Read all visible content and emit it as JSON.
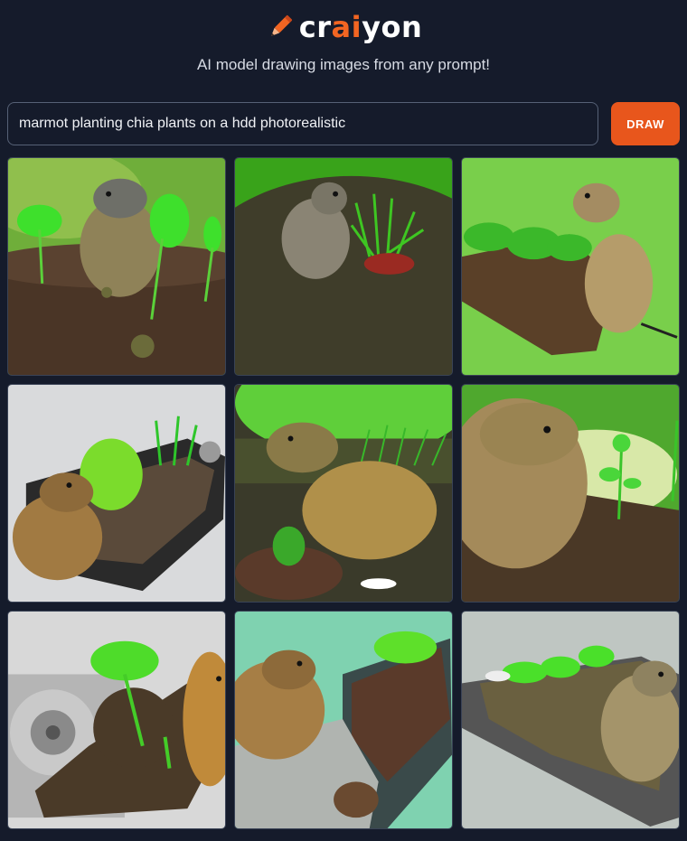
{
  "brand": {
    "name_parts": [
      "cr",
      "ai",
      "yon"
    ],
    "logo_icon": "pencil-icon",
    "accent_color": "#f26522"
  },
  "tagline": "AI model drawing images from any prompt!",
  "prompt": {
    "value": "marmot planting chia plants on a hdd photorealistic"
  },
  "draw_button": {
    "label": "DRAW",
    "color": "#e8561c"
  },
  "results": {
    "count": 9,
    "items": [
      {
        "subject": "marmot with green sprouts in soil"
      },
      {
        "subject": "marmot beside potted chia plant"
      },
      {
        "subject": "marmot with chia sprouts on soil bed"
      },
      {
        "subject": "marmot on hard drive with sprouts"
      },
      {
        "subject": "marmot planting chia in field"
      },
      {
        "subject": "marmot close-up with seedlings"
      },
      {
        "subject": "hard drive platter with soil and plant"
      },
      {
        "subject": "marmot on drive tray with soil"
      },
      {
        "subject": "marmot on hard drive with green sprouts"
      }
    ]
  }
}
